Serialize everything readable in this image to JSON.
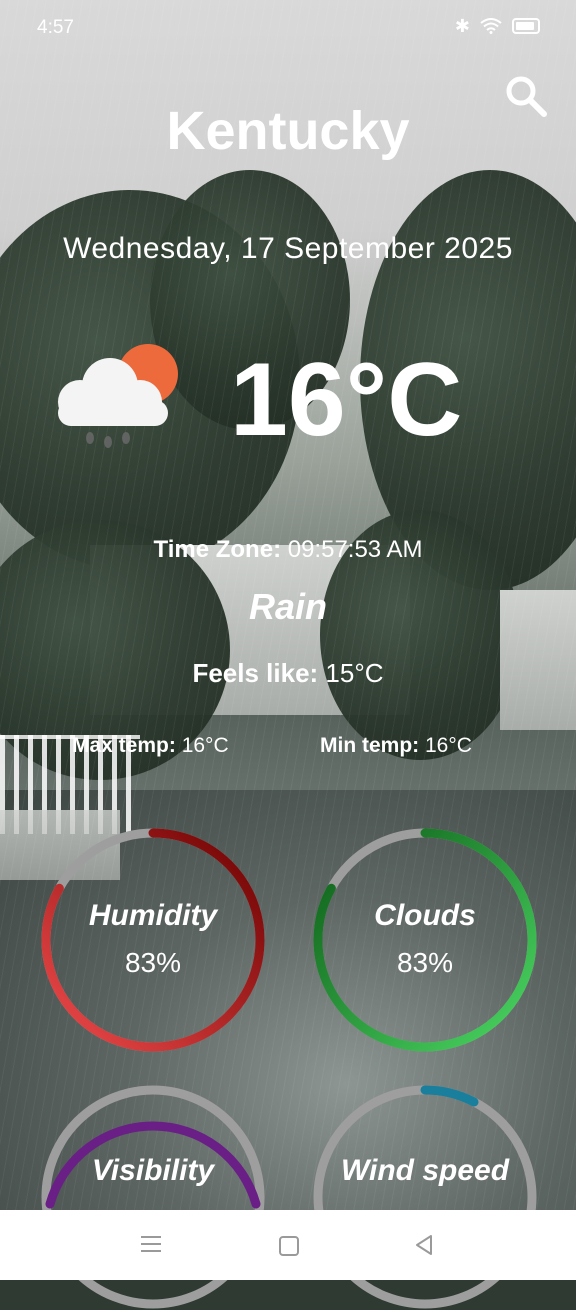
{
  "status_bar": {
    "time": "4:57"
  },
  "header": {
    "city": "Kentucky",
    "date": "Wednesday, 17 September 2025"
  },
  "current": {
    "temperature": "16°C",
    "time_zone_label": "Time Zone:",
    "time_zone_value": " 09:57:53 AM",
    "condition": "Rain",
    "feels_like_label": "Feels like:",
    "feels_like_value": " 15°C",
    "max_temp_label": "Max temp:",
    "max_temp_value": " 16°C",
    "min_temp_label": "Min temp:",
    "min_temp_value": " 16°C"
  },
  "gauges": {
    "humidity": {
      "label": "Humidity",
      "value": "83%",
      "fraction": 0.83,
      "color_start": "#f04b4b",
      "color_end": "#6b0000"
    },
    "clouds": {
      "label": "Clouds",
      "value": "83%",
      "fraction": 0.83,
      "color_start": "#4cd964",
      "color_end": "#0c5a16"
    },
    "visibility": {
      "label": "Visibility",
      "color_start": "#a53ac0",
      "color_end": "#3d0b54"
    },
    "wind_speed": {
      "label": "Wind speed",
      "color_start": "#1a8aa6",
      "color_end": "#0d4f66"
    }
  },
  "icons": {
    "search": "search-icon",
    "weather": "cloud-sun-rain-icon",
    "nav_menu": "menu-icon",
    "nav_home": "home-icon",
    "nav_back": "back-icon"
  },
  "colors": {
    "text": "#ffffff",
    "track": "#9e9e9e",
    "sun": "#ec6a3c"
  }
}
